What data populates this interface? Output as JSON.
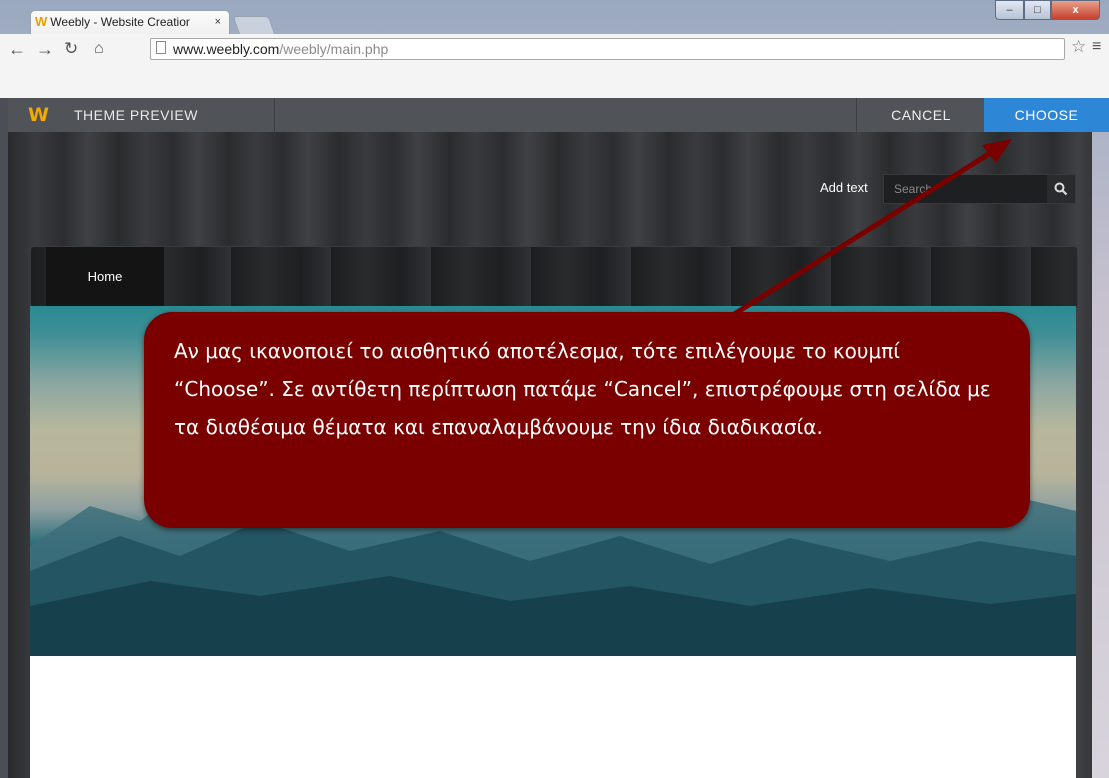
{
  "browser": {
    "tab_title": "Weebly - Website Creatior",
    "tab_close": "×",
    "url_host": "www.weebly.com",
    "url_path": "/weebly/main.php",
    "controls": {
      "minimize": "–",
      "maximize": "□",
      "close": "x"
    }
  },
  "weebly_bar": {
    "logo": "W",
    "title": "THEME PREVIEW",
    "cancel_label": "CANCEL",
    "choose_label": "CHOOSE"
  },
  "site": {
    "add_text": "Add text",
    "search_placeholder": "Search",
    "nav": {
      "home": "Home"
    }
  },
  "callout": {
    "text": "Αν μας ικανοποιεί το αισθητικό αποτέλεσμα, τότε επιλέγουμε το κουμπί “Choose”. Σε αντίθετη περίπτωση πατάμε “Cancel”, επιστρέφουμε στη σελίδα με τα διαθέσιμα θέματα και επαναλαμβάνουμε την ίδια διαδικασία."
  },
  "colors": {
    "accent_blue": "#2e86d6",
    "callout_red": "#7a0000",
    "weebly_orange": "#f2a900"
  }
}
